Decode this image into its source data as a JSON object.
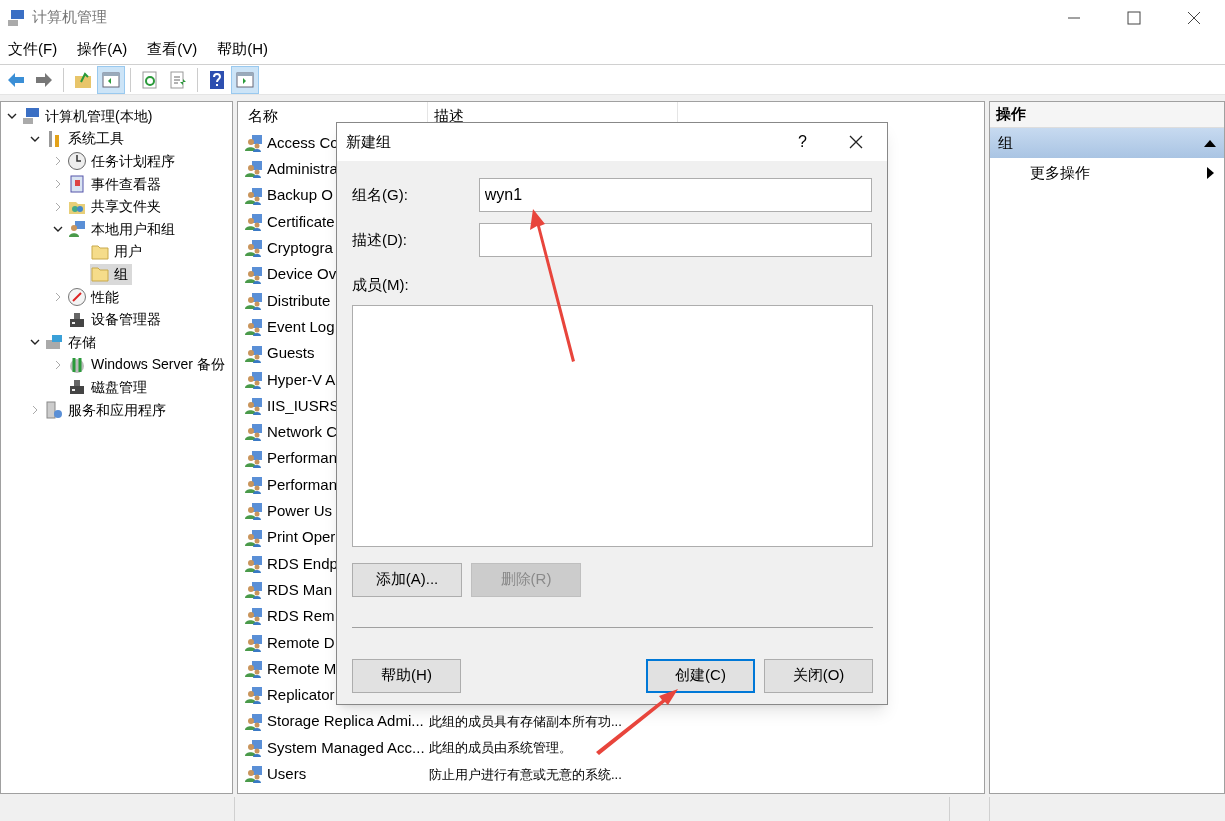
{
  "window": {
    "title": "计算机管理"
  },
  "menu": [
    "文件(F)",
    "操作(A)",
    "查看(V)",
    "帮助(H)"
  ],
  "toolbar": [
    {
      "pressed": false
    },
    {
      "pressed": false
    },
    {
      "pressed": false
    },
    {
      "pressed": true
    },
    {
      "pressed": false
    },
    {
      "pressed": false
    },
    {
      "pressed": false
    },
    {
      "pressed": true
    }
  ],
  "tree": [
    {
      "label": "计算机管理(本地)",
      "expanded": true,
      "selected": false,
      "children": [
        {
          "label": "系统工具",
          "expanded": true,
          "selected": false,
          "children": [
            {
              "label": "任务计划程序",
              "expanded": false,
              "selected": false
            },
            {
              "label": "事件查看器",
              "expanded": false,
              "selected": false
            },
            {
              "label": "共享文件夹",
              "expanded": false,
              "selected": false
            },
            {
              "label": "本地用户和组",
              "expanded": true,
              "selected": false,
              "children": [
                {
                  "label": "用户",
                  "selected": false
                },
                {
                  "label": "组",
                  "selected": true
                }
              ]
            },
            {
              "label": "性能",
              "expanded": false,
              "selected": false
            },
            {
              "label": "设备管理器",
              "selected": false
            }
          ]
        },
        {
          "label": "存储",
          "expanded": true,
          "selected": false,
          "children": [
            {
              "label": "Windows Server 备份",
              "expanded": false,
              "selected": false
            },
            {
              "label": "磁盘管理",
              "selected": false
            }
          ]
        },
        {
          "label": "服务和应用程序",
          "expanded": false,
          "selected": false
        }
      ]
    }
  ],
  "list": {
    "columns": [
      "名称",
      "描述"
    ],
    "rows": [
      {
        "name": "Access Co"
      },
      {
        "name": "Administra"
      },
      {
        "name": "Backup O"
      },
      {
        "name": "Certificate"
      },
      {
        "name": "Cryptogra"
      },
      {
        "name": "Device Ov"
      },
      {
        "name": "Distribute"
      },
      {
        "name": "Event Log"
      },
      {
        "name": "Guests"
      },
      {
        "name": "Hyper-V A"
      },
      {
        "name": "IIS_IUSRS"
      },
      {
        "name": "Network C"
      },
      {
        "name": "Performan"
      },
      {
        "name": "Performan"
      },
      {
        "name": "Power Us"
      },
      {
        "name": "Print Oper"
      },
      {
        "name": "RDS Endp"
      },
      {
        "name": "RDS Man"
      },
      {
        "name": "RDS Rem"
      },
      {
        "name": "Remote D"
      },
      {
        "name": "Remote M"
      },
      {
        "name": "Replicator"
      },
      {
        "name": "Storage Replica Admi...",
        "description": "此组的成员具有存储副本所有功..."
      },
      {
        "name": "System Managed Acc...",
        "description": "此组的成员由系统管理。"
      },
      {
        "name": "Users",
        "description": "防止用户进行有意或无意的系统..."
      }
    ]
  },
  "actions": {
    "title": "操作",
    "sections": [
      {
        "label": "组",
        "expanded": true,
        "items": [
          {
            "label": "更多操作"
          }
        ]
      }
    ]
  },
  "dialog": {
    "title": "新建组",
    "help_glyph": "?",
    "fields": [
      {
        "label": "组名(G):",
        "value": "wyn1"
      },
      {
        "label": "描述(D):"
      }
    ],
    "members_label": "成员(M):",
    "member_buttons": [
      {
        "label": "添加(A)...",
        "disabled": false
      },
      {
        "label": "删除(R)",
        "disabled": true
      }
    ],
    "footer_buttons": [
      {
        "label": "帮助(H)",
        "default": false
      },
      {
        "label": "创建(C)",
        "default": true
      },
      {
        "label": "关闭(O)",
        "default": false
      }
    ]
  }
}
